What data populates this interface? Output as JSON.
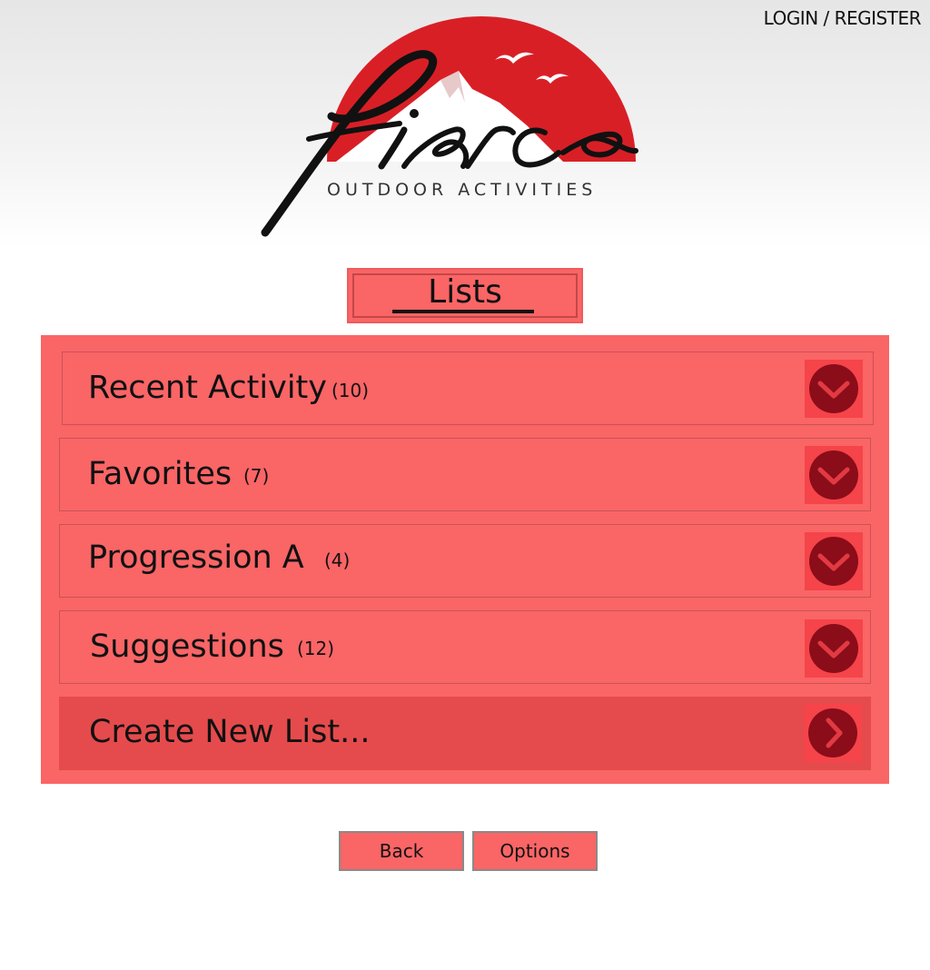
{
  "header": {
    "auth_link": "LOGIN / REGISTER"
  },
  "logo": {
    "wordmark": "fierce",
    "tagline": "OUTDOOR ACTIVITIES"
  },
  "page": {
    "title": "Lists"
  },
  "lists": [
    {
      "label": "Recent Activity",
      "count": "(10)"
    },
    {
      "label": "Favorites",
      "count": "(7)"
    },
    {
      "label": "Progression A",
      "count": "(4)"
    },
    {
      "label": "Suggestions",
      "count": "(12)"
    }
  ],
  "create_list": {
    "label": "Create New List..."
  },
  "footer": {
    "back_label": "Back",
    "options_label": "Options"
  },
  "colors": {
    "panel": "#fa6566",
    "create_row": "#e54b4c",
    "chevron_box": "#f5444a",
    "chevron_circle": "#8b0d19",
    "logo_sun": "#d91f26"
  },
  "icons": {
    "list_row": "chevron-down-icon",
    "create_row": "chevron-right-icon"
  }
}
